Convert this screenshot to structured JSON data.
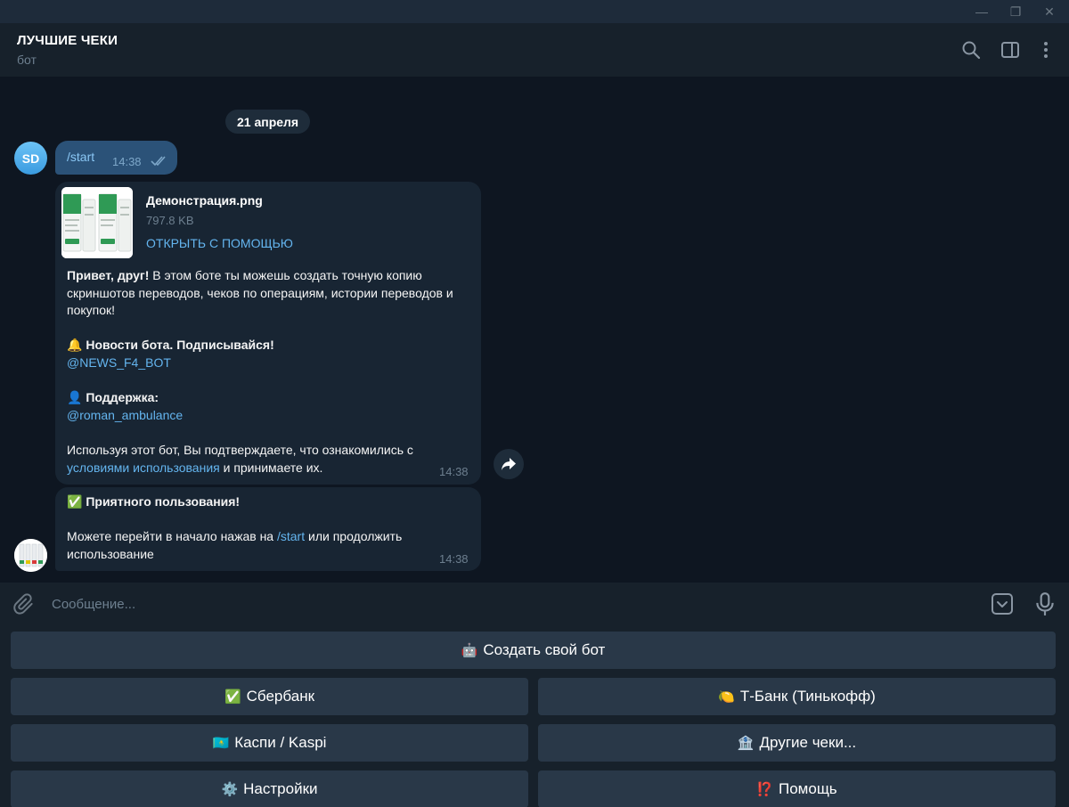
{
  "window": {
    "minimize": "—",
    "restore": "❐",
    "close": "✕"
  },
  "chat": {
    "title": "ЛУЧШИЕ ЧЕКИ",
    "subtitle": "бот"
  },
  "header_icons": [
    "search-icon",
    "sidebar-toggle-icon",
    "more-vertical-icon"
  ],
  "date": "21 апреля",
  "outgoing": {
    "avatar_initials": "SD",
    "text": "/start",
    "time": "14:38",
    "status": "read"
  },
  "file": {
    "name": "Демонстрация.png",
    "size": "797.8 KB",
    "action": "ОТКРЫТЬ С ПОМОЩЬЮ"
  },
  "welcome": {
    "greeting_bold": "Привет, друг!",
    "greeting_rest": " В этом боте ты можешь создать точную копию скриншотов переводов, чеков по операциям, истории переводов и покупок!",
    "news_emoji": "🔔",
    "news_label": "Новости бота. Подписывайся!",
    "news_link": "@NEWS_F4_BOT",
    "support_emoji": "👤",
    "support_label": "Поддержка:",
    "support_link": "@roman_ambulance",
    "terms_before": "Используя этот бот, Вы подтверждаете, что ознакомились с ",
    "terms_link": "условиями использования",
    "terms_after": " и принимаете их.",
    "time": "14:38"
  },
  "second": {
    "emoji": "✅",
    "title": "Приятного пользования!",
    "text_before": "Можете перейти в начало нажав на ",
    "link": "/start",
    "text_after": " или продолжить использование",
    "time": "14:38"
  },
  "composer": {
    "placeholder": "Сообщение..."
  },
  "keyboard": {
    "create_bot": {
      "emoji": "🤖",
      "label": "Создать свой бот"
    },
    "sberbank": {
      "emoji": "✅",
      "label": "Сбербанк"
    },
    "tbank": {
      "emoji": "🍋",
      "label": "Т-Банк (Тинькофф)"
    },
    "kaspi": {
      "emoji": "🇰🇿",
      "label": "Каспи / Kaspi"
    },
    "other": {
      "emoji": "🏦",
      "label": "Другие чеки..."
    },
    "settings": {
      "emoji": "⚙️",
      "label": "Настройки"
    },
    "help": {
      "emoji": "⁉️",
      "label": "Помощь"
    }
  },
  "colors": {
    "background": "#0e1621",
    "panel": "#17212b",
    "bubble_in": "#182533",
    "bubble_out": "#2b5278",
    "accent": "#64b5ef",
    "keyboard_button": "#293848"
  }
}
